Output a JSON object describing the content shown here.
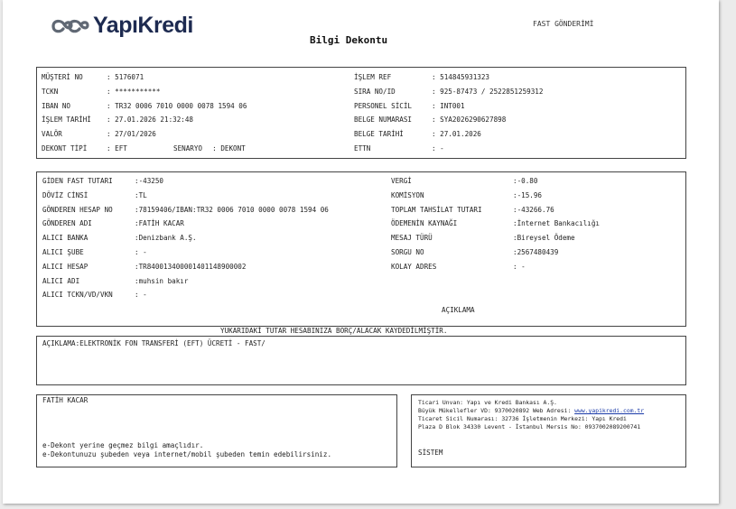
{
  "header": {
    "brand": "YapıKredi",
    "fast_title": "FAST GÖNDERİMİ",
    "doc_title": "Bilgi Dekontu"
  },
  "customer": {
    "left": [
      {
        "label": "MÜŞTERİ NO",
        "value": ": 5176071"
      },
      {
        "label": "TCKN",
        "value": ": ***********"
      },
      {
        "label": "IBAN NO",
        "value": ": TR32 0006 7010 0000 0078 1594 06"
      },
      {
        "label": "İŞLEM TARİHİ",
        "value": ": 27.01.2026 21:32:48"
      },
      {
        "label": "VALÖR",
        "value": ": 27/01/2026"
      },
      {
        "label": "DEKONT TİPİ",
        "value": ": EFT"
      }
    ],
    "scenario_label": "SENARYO",
    "scenario_value": ": DEKONT",
    "right": [
      {
        "label": "İŞLEM REF",
        "value": ": 514845931323"
      },
      {
        "label": "SIRA NO/ID",
        "value": ": 925-87473 / 2522851259312"
      },
      {
        "label": "PERSONEL SİCİL",
        "value": ": INT001"
      },
      {
        "label": "BELGE NUMARASI",
        "value": ": SYA2026290627898"
      },
      {
        "label": "BELGE TARİHİ",
        "value": ": 27.01.2026"
      },
      {
        "label": "ETTN",
        "value": ": -"
      }
    ]
  },
  "transfer": {
    "left": [
      {
        "label": "GİDEN FAST TUTARI",
        "value": ":-43250"
      },
      {
        "label": "DÖVİZ CİNSİ",
        "value": ":TL"
      },
      {
        "label": "GÖNDEREN HESAP NO",
        "value": ":78159406/IBAN:TR32 0006 7010 0000 0078 1594 06"
      },
      {
        "label": "GÖNDEREN ADI",
        "value": ":FATİH KACAR"
      },
      {
        "label": "ALICI BANKA",
        "value": ":Denizbank A.Ş."
      },
      {
        "label": "ALICI ŞUBE",
        "value": ": -"
      },
      {
        "label": "ALICI HESAP",
        "value": ":TR840013400001401148900002"
      },
      {
        "label": "ALICI ADI",
        "value": ":muhsin bakır"
      },
      {
        "label": "ALICI TCKN/VD/VKN",
        "value": ": -"
      }
    ],
    "right": [
      {
        "label": "VERGİ",
        "value": ":-0.80"
      },
      {
        "label": "KOMİSYON",
        "value": ":-15.96"
      },
      {
        "label": "TOPLAM TAHSİLAT TUTARI",
        "value": ":-43266.76"
      },
      {
        "label": "ÖDEMENİN KAYNAĞI",
        "value": ":İnternet Bankacılığı"
      },
      {
        "label": "MESAJ TÜRÜ",
        "value": ":Bireysel Ödeme"
      },
      {
        "label": "SORGU NO",
        "value": ":2567480439"
      },
      {
        "label": "KOLAY ADRES",
        "value": ": -"
      }
    ],
    "aciklama_heading": "AÇIKLAMA"
  },
  "debit_note": "YUKARIDAKİ TUTAR HESABINIZA BORÇ/ALACAK KAYDEDİLMİŞTİR.",
  "description": "AÇIKLAMA:ELEKTRONİK FON TRANSFERİ (EFT) ÜCRETİ - FAST/",
  "footer_left": {
    "name": "FATİH KACAR",
    "note1": "e-Dekont yerine geçmez bilgi amaçlıdır.",
    "note2": "e-Dekontunuzu şubeden veya internet/mobil şubeden temin edebilirsiniz."
  },
  "footer_right": {
    "line1": "Ticari Unvan: Yapı ve Kredi Bankası A.Ş.",
    "line2_prefix": "Büyük Mükellefler VD: 9370020892 Web Adresi: ",
    "web": "www.yapikredi.com.tr",
    "line3": "Ticaret Sicil Numarası: 32736 İşletmenin Merkezi: Yapı Kredi",
    "line4": "Plaza D Blok 34330 Levent - İstanbul Mersis No: 0937002089200741",
    "system": "SİSTEM"
  }
}
